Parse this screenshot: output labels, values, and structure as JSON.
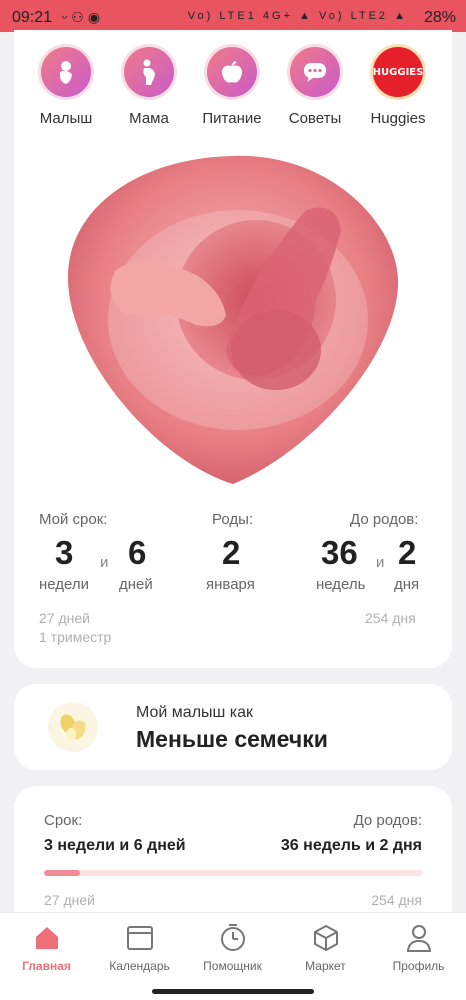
{
  "status": {
    "time": "09:21",
    "battery": "28%",
    "network1": "Vo) LTE1 4G+",
    "network2": "Vo) LTE2"
  },
  "categories": [
    {
      "label": "Малыш",
      "icon": "baby-icon"
    },
    {
      "label": "Мама",
      "icon": "pregnant-mom-icon"
    },
    {
      "label": "Питание",
      "icon": "apple-icon"
    },
    {
      "label": "Советы",
      "icon": "chat-bubble-icon"
    },
    {
      "label": "Huggies",
      "icon": "huggies-logo",
      "logo_text": "HUGGIES"
    }
  ],
  "stats": {
    "term_label": "Мой срок:",
    "term_weeks": "3",
    "term_weeks_unit": "недели",
    "term_and": "и",
    "term_days": "6",
    "term_days_unit": "дней",
    "birth_label": "Роды:",
    "birth_day": "2",
    "birth_month": "января",
    "until_label": "До родов:",
    "until_weeks": "36",
    "until_weeks_unit": "недель",
    "until_and": "и",
    "until_days": "2",
    "until_days_unit": "дня",
    "days_passed": "27 дней",
    "trimester": "1 триместр",
    "days_left": "254 дня"
  },
  "size_card": {
    "subtitle": "Мой малыш как",
    "title": "Меньше семечки"
  },
  "progress_card": {
    "term_label": "Срок:",
    "term_value": "3 недели и 6 дней",
    "until_label": "До родов:",
    "until_value": "36 недель и 2 дня",
    "days_passed": "27 дней",
    "days_left": "254 дня",
    "progress_fraction": 0.096
  },
  "nav": [
    {
      "label": "Главная",
      "icon": "home-icon",
      "active": true
    },
    {
      "label": "Календарь",
      "icon": "calendar-icon",
      "active": false
    },
    {
      "label": "Помощник",
      "icon": "timer-icon",
      "active": false
    },
    {
      "label": "Маркет",
      "icon": "box-icon",
      "active": false
    },
    {
      "label": "Профиль",
      "icon": "user-icon",
      "active": false
    }
  ],
  "colors": {
    "accent": "#f0707a",
    "category_gradient_start": "#f07b88",
    "category_gradient_end": "#c95bc9",
    "progress_fill": "#f08d93",
    "progress_track": "#fde3e5"
  }
}
